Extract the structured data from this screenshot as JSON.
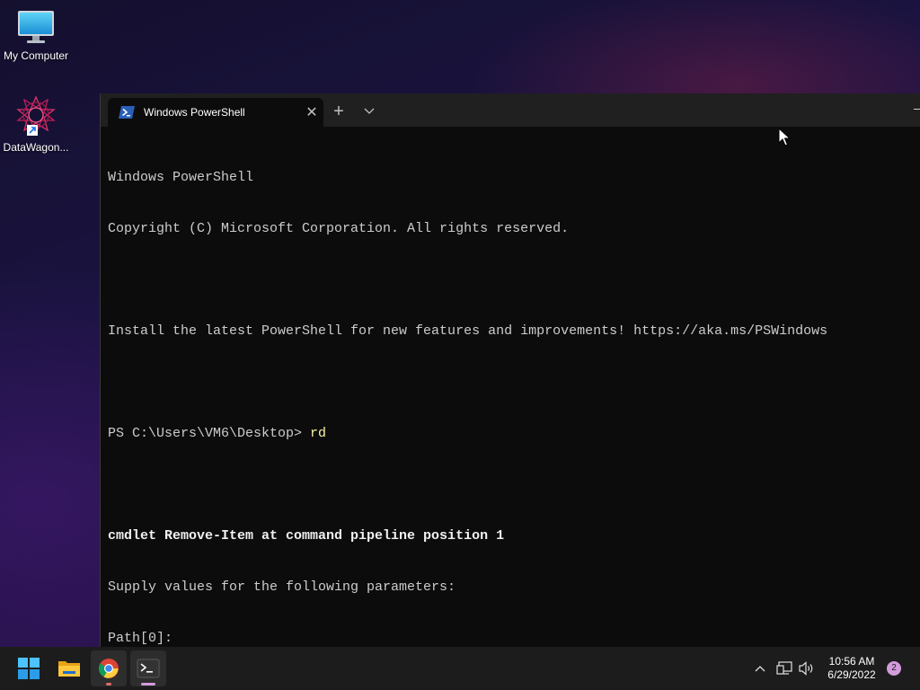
{
  "desktop": {
    "icons": [
      {
        "label": "My Computer",
        "icon": "monitor-icon"
      },
      {
        "label": "DataWagon...",
        "icon": "datawagon-icon"
      }
    ]
  },
  "terminal": {
    "tab_title": "Windows PowerShell",
    "tab_icon": "powershell-icon",
    "new_tab": "+",
    "close": "✕",
    "lines": [
      "Windows PowerShell",
      "Copyright (C) Microsoft Corporation. All rights reserved.",
      "",
      "Install the latest PowerShell for new features and improvements! https://aka.ms/PSWindows",
      "",
      "PS C:\\Users\\VM6\\Desktop> ",
      "",
      "cmdlet Remove-Item at command pipeline position 1",
      "Supply values for the following parameters:",
      "Path[0]: "
    ],
    "typed_command": "rd",
    "colors": {
      "background": "#0c0c0c",
      "text": "#cccccc",
      "command": "#f9f1a5",
      "titlebar": "#202020"
    }
  },
  "taskbar": {
    "apps": [
      {
        "name": "Start",
        "icon": "windows-start-icon"
      },
      {
        "name": "File Explorer",
        "icon": "folder-icon"
      },
      {
        "name": "Google Chrome",
        "icon": "chrome-icon"
      },
      {
        "name": "Windows Terminal",
        "icon": "terminal-icon"
      }
    ],
    "tray": {
      "icons": [
        "chevron-up-icon",
        "network-icon",
        "volume-icon"
      ],
      "time": "10:56 AM",
      "date": "6/29/2022",
      "notification_count": "2"
    }
  }
}
